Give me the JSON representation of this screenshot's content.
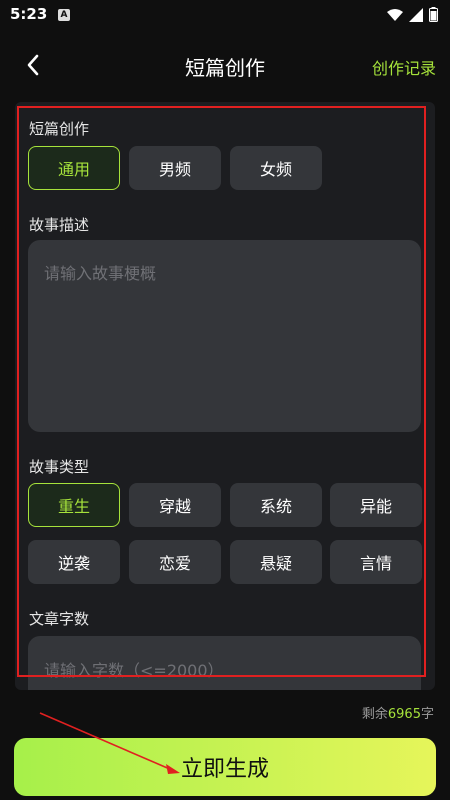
{
  "status": {
    "time": "5:23",
    "notif": "A"
  },
  "header": {
    "title": "短篇创作",
    "history": "创作记录"
  },
  "category": {
    "label": "短篇创作",
    "options": [
      "通用",
      "男频",
      "女频"
    ],
    "selected": "通用"
  },
  "description": {
    "label": "故事描述",
    "placeholder": "请输入故事梗概"
  },
  "types": {
    "label": "故事类型",
    "options": [
      "重生",
      "穿越",
      "系统",
      "异能",
      "逆袭",
      "恋爱",
      "悬疑",
      "言情"
    ],
    "selected": "重生"
  },
  "wordcount": {
    "label": "文章字数",
    "placeholder": "请输入字数（<=2000）"
  },
  "remaining": {
    "prefix": "剩余",
    "count": "6965",
    "suffix": "字"
  },
  "generate": {
    "label": "立即生成"
  },
  "colors": {
    "accent": "#a6e33b",
    "annotation": "#e02020"
  }
}
